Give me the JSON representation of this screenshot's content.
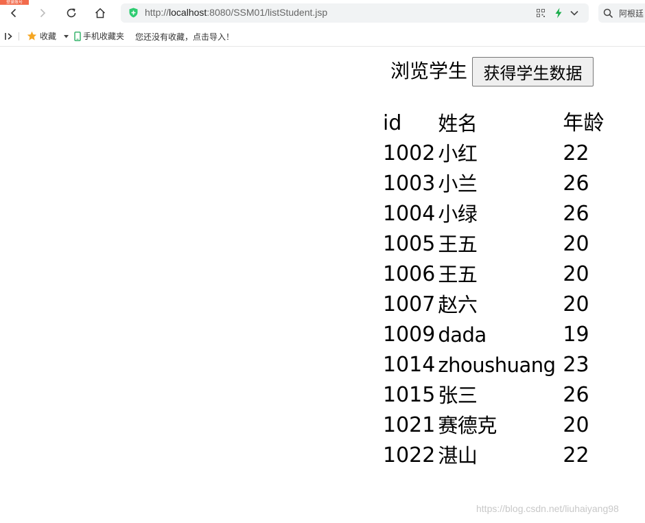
{
  "browser": {
    "corner_tag": "登录账号",
    "url_scheme": "http://",
    "url_host": "localhost",
    "url_path": ":8080/SSM01/listStudent.jsp",
    "search_text": "阿根廷"
  },
  "bookmarks_bar": {
    "favorites_label": "收藏",
    "mobile_label": "手机收藏夹",
    "empty_hint": "您还没有收藏，点击导入！"
  },
  "page": {
    "title": "浏览学生",
    "fetch_button_label": "获得学生数据",
    "table": {
      "headers": [
        "id",
        "姓名",
        "年龄"
      ],
      "rows": [
        {
          "id": "1002",
          "name": "小红",
          "age": "22"
        },
        {
          "id": "1003",
          "name": "小兰",
          "age": "26"
        },
        {
          "id": "1004",
          "name": "小绿",
          "age": "26"
        },
        {
          "id": "1005",
          "name": "王五",
          "age": "20"
        },
        {
          "id": "1006",
          "name": "王五",
          "age": "20"
        },
        {
          "id": "1007",
          "name": "赵六",
          "age": "20"
        },
        {
          "id": "1009",
          "name": "dada",
          "age": "19"
        },
        {
          "id": "1014",
          "name": "zhoushuang",
          "age": "23"
        },
        {
          "id": "1015",
          "name": "张三",
          "age": "26"
        },
        {
          "id": "1021",
          "name": "赛德克",
          "age": "20"
        },
        {
          "id": "1022",
          "name": "湛山",
          "age": "22"
        }
      ]
    }
  },
  "watermark": "https://blog.csdn.net/liuhaiyang98",
  "colors": {
    "shield": "#2ecc71",
    "bolt": "#1aad4b",
    "star": "#f5a623",
    "mobile_icon": "#27ae60",
    "corner_tag": "#f26a4b"
  },
  "icons": [
    "back-icon",
    "forward-icon",
    "reload-icon",
    "home-icon",
    "shield-icon",
    "qr-icon",
    "bolt-icon",
    "chevron-down-icon",
    "search-icon",
    "sidebar-toggle-icon",
    "star-icon",
    "caret-down-icon",
    "mobile-icon"
  ]
}
